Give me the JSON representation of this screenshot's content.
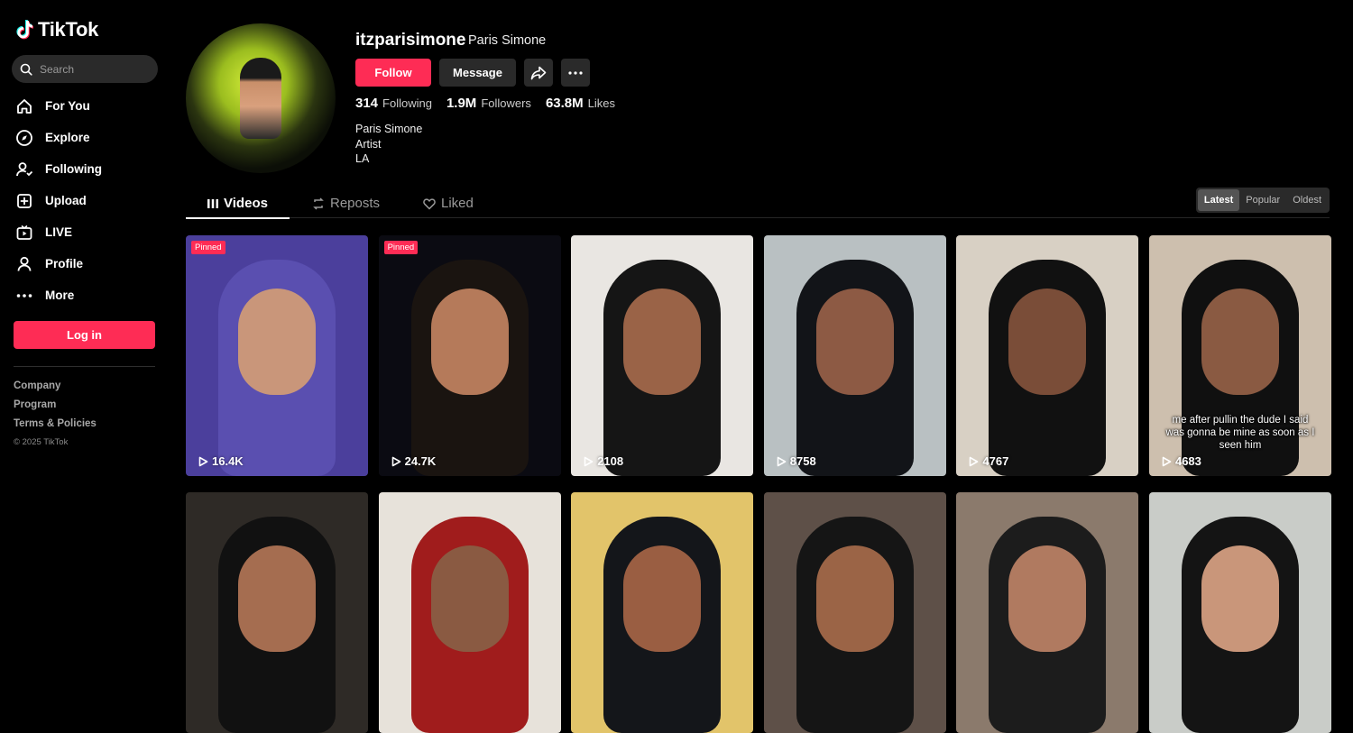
{
  "brand": {
    "name": "TikTok",
    "accent": "#fe2c55"
  },
  "search": {
    "placeholder": "Search"
  },
  "nav": [
    {
      "label": "For You",
      "icon": "home-icon"
    },
    {
      "label": "Explore",
      "icon": "compass-icon"
    },
    {
      "label": "Following",
      "icon": "person-follow-icon"
    },
    {
      "label": "Upload",
      "icon": "upload-icon"
    },
    {
      "label": "LIVE",
      "icon": "live-tv-icon"
    },
    {
      "label": "Profile",
      "icon": "person-icon"
    },
    {
      "label": "More",
      "icon": "more-dots-icon"
    }
  ],
  "login_label": "Log in",
  "footer": {
    "links": [
      "Company",
      "Program",
      "Terms & Policies"
    ],
    "copyright": "© 2025 TikTok"
  },
  "profile": {
    "username": "itzparisimone",
    "nickname": "Paris Simone",
    "follow_label": "Follow",
    "message_label": "Message",
    "stats": [
      {
        "num": "314",
        "label": "Following"
      },
      {
        "num": "1.9M",
        "label": "Followers"
      },
      {
        "num": "63.8M",
        "label": "Likes"
      }
    ],
    "bio": [
      "Paris Simone",
      "Artist",
      "LA"
    ]
  },
  "tabs": {
    "videos": "Videos",
    "reposts": "Reposts",
    "liked": "Liked"
  },
  "sort": {
    "options": [
      "Latest",
      "Popular",
      "Oldest"
    ],
    "active": "Latest"
  },
  "videos": [
    {
      "views": "16.4K",
      "pinned": "Pinned",
      "bg": "#4b3f9c",
      "hair": "#5a4fb0",
      "skin": "#c9967a",
      "caption": ""
    },
    {
      "views": "24.7K",
      "pinned": "Pinned",
      "bg": "#0b0b12",
      "hair": "#1a1410",
      "skin": "#b57a5a",
      "caption": ""
    },
    {
      "views": "2108",
      "pinned": "",
      "bg": "#e9e6e2",
      "hair": "#151515",
      "skin": "#9a6347",
      "caption": ""
    },
    {
      "views": "8758",
      "pinned": "",
      "bg": "#b9c0c2",
      "hair": "#121418",
      "skin": "#8d5a44",
      "caption": ""
    },
    {
      "views": "4767",
      "pinned": "",
      "bg": "#d8d0c4",
      "hair": "#111111",
      "skin": "#7a4d38",
      "caption": ""
    },
    {
      "views": "4683",
      "pinned": "",
      "bg": "#cdbfae",
      "hair": "#101010",
      "skin": "#8a5a42",
      "caption": "me after pullin the dude I said was gonna be mine as soon as I seen him"
    },
    {
      "views": "",
      "pinned": "",
      "bg": "#2e2a26",
      "hair": "#111111",
      "skin": "#a56d50",
      "caption": ""
    },
    {
      "views": "",
      "pinned": "",
      "bg": "#e7e2da",
      "hair": "#a01c1c",
      "skin": "#8a5a42",
      "caption": ""
    },
    {
      "views": "",
      "pinned": "",
      "bg": "#e2c46a",
      "hair": "#14161a",
      "skin": "#9a5e42",
      "caption": ""
    },
    {
      "views": "",
      "pinned": "",
      "bg": "#5e5048",
      "hair": "#151515",
      "skin": "#9b6446",
      "caption": ""
    },
    {
      "views": "",
      "pinned": "",
      "bg": "#8b7a6c",
      "hair": "#1c1c1c",
      "skin": "#b07a60",
      "caption": ""
    },
    {
      "views": "",
      "pinned": "",
      "bg": "#c9ccc8",
      "hair": "#141414",
      "skin": "#c9967a",
      "caption": ""
    }
  ]
}
